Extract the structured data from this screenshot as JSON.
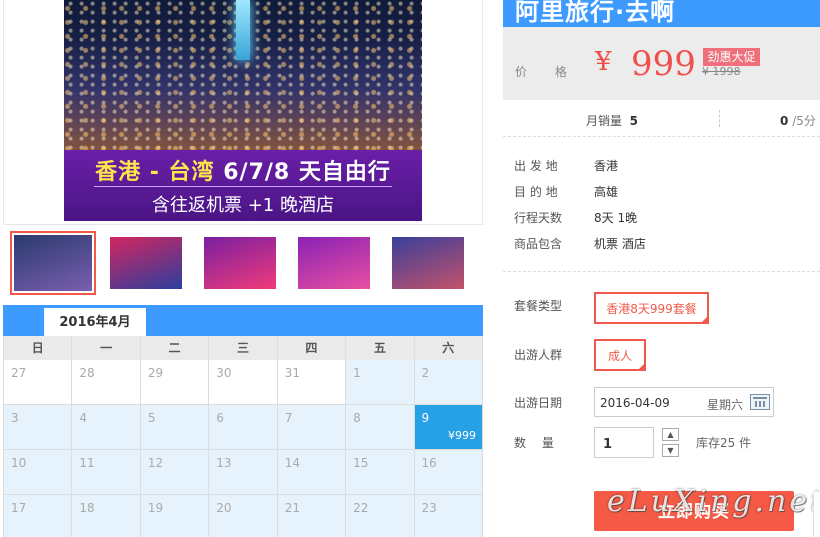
{
  "hero": {
    "title_part1": "香港 - 台湾",
    "title_part2": "6/7/8 天自由行",
    "subtitle": "含往返机票 +1 晚酒店"
  },
  "thumbnails": [
    {
      "label": "thumbnail-1",
      "colors": [
        "#2a3a6e",
        "#7a5fb0"
      ],
      "selected": true
    },
    {
      "label": "thumbnail-2",
      "colors": [
        "#d42560",
        "#2b3f9e"
      ],
      "selected": false
    },
    {
      "label": "thumbnail-3",
      "colors": [
        "#7a1fa0",
        "#f03b7a"
      ],
      "selected": false
    },
    {
      "label": "thumbnail-4",
      "colors": [
        "#8a22b5",
        "#e84fa0"
      ],
      "selected": false
    },
    {
      "label": "thumbnail-5",
      "colors": [
        "#3a3f9a",
        "#c4526a"
      ],
      "selected": false
    }
  ],
  "calendar": {
    "month": "2016年4月",
    "weekdays": [
      "日",
      "一",
      "二",
      "三",
      "四",
      "五",
      "六"
    ],
    "rows": [
      [
        {
          "d": "27",
          "t": "w"
        },
        {
          "d": "28",
          "t": "w"
        },
        {
          "d": "29",
          "t": "w"
        },
        {
          "d": "30",
          "t": "w"
        },
        {
          "d": "31",
          "t": "w"
        },
        {
          "d": "1",
          "t": "b"
        },
        {
          "d": "2",
          "t": "b"
        }
      ],
      [
        {
          "d": "3",
          "t": "b"
        },
        {
          "d": "4",
          "t": "b"
        },
        {
          "d": "5",
          "t": "b"
        },
        {
          "d": "6",
          "t": "b"
        },
        {
          "d": "7",
          "t": "b"
        },
        {
          "d": "8",
          "t": "b"
        },
        {
          "d": "9",
          "t": "s",
          "p": "¥999"
        }
      ],
      [
        {
          "d": "10",
          "t": "b"
        },
        {
          "d": "11",
          "t": "b"
        },
        {
          "d": "12",
          "t": "b"
        },
        {
          "d": "13",
          "t": "b"
        },
        {
          "d": "14",
          "t": "b"
        },
        {
          "d": "15",
          "t": "b"
        },
        {
          "d": "16",
          "t": "b"
        }
      ],
      [
        {
          "d": "17",
          "t": "b"
        },
        {
          "d": "18",
          "t": "b"
        },
        {
          "d": "19",
          "t": "b"
        },
        {
          "d": "20",
          "t": "b"
        },
        {
          "d": "21",
          "t": "b"
        },
        {
          "d": "22",
          "t": "b"
        },
        {
          "d": "23",
          "t": "b"
        }
      ]
    ]
  },
  "product": {
    "title": "阿里旅行·去啊",
    "price_label": "价    格",
    "currency": "¥",
    "price": "999",
    "promo_badge": "劲惠大促",
    "original_price": "¥ 1998",
    "monthly_sales_label": "月销量",
    "monthly_sales": "5",
    "rating": "0",
    "rating_suffix": "/5分"
  },
  "details": [
    {
      "k": "出 发 地",
      "v": "香港"
    },
    {
      "k": "目 的 地",
      "v": "高雄"
    },
    {
      "k": "行程天数",
      "v": "8天 1晚"
    },
    {
      "k": "商品包含",
      "v": "机票   酒店"
    }
  ],
  "options": {
    "package_label": "套餐类型",
    "package_value": "香港8天999套餐",
    "group_label": "出游人群",
    "group_value": "成人",
    "date_label": "出游日期",
    "date_value": "2016-04-09",
    "date_weekday": "星期六",
    "qty_label": "数    量",
    "qty_value": "1",
    "stock": "库存25 件"
  },
  "buy_label": "立即购买",
  "watermark": "eLuXing.net",
  "colors": {
    "accent": "#3d9bff",
    "price": "#f1504a",
    "buy": "#f55a47"
  }
}
